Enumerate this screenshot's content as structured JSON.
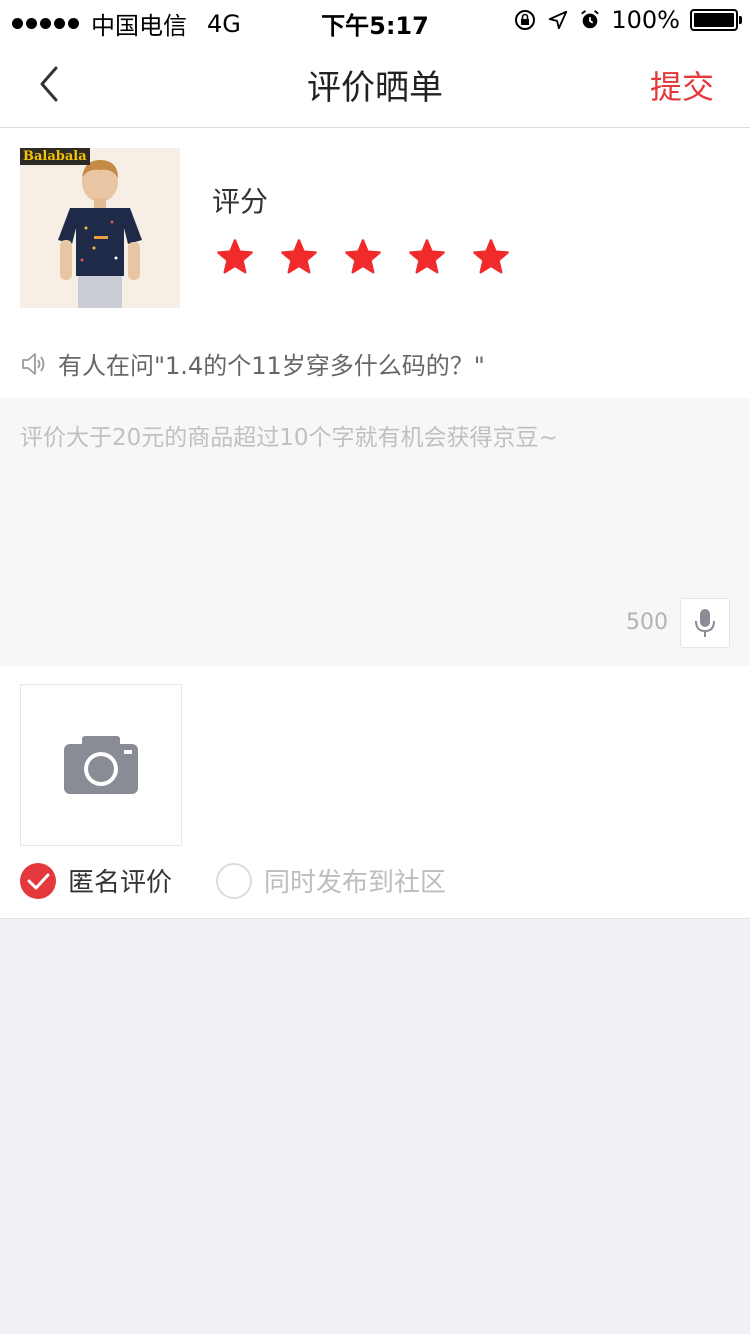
{
  "status_bar": {
    "carrier": "中国电信",
    "network": "4G",
    "time": "下午5:17",
    "battery": "100%"
  },
  "nav": {
    "title": "评价晒单",
    "submit_label": "提交"
  },
  "product": {
    "brand": "Balabala",
    "rating_label": "评分",
    "stars": 5,
    "star_color": "#f12b2b"
  },
  "hint": {
    "text": "有人在问\"1.4的个11岁穿多什么码的？\""
  },
  "review": {
    "placeholder": "评价大于20元的商品超过10个字就有机会获得京豆~",
    "char_limit": "500"
  },
  "options": {
    "anonymous_label": "匿名评价",
    "anonymous_checked": true,
    "community_label": "同时发布到社区",
    "community_checked": false
  },
  "colors": {
    "accent": "#e4393c",
    "background": "#f0f1f5"
  }
}
